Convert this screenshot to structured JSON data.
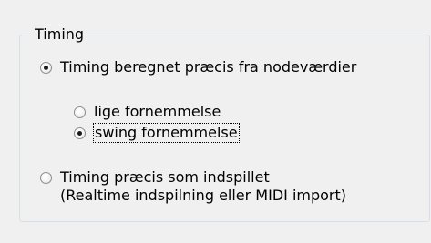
{
  "group": {
    "title": "Timing"
  },
  "options": {
    "calculated": {
      "label": "Timing beregnet præcis fra nodeværdier",
      "checked": true
    },
    "straight": {
      "label": "lige fornemmelse",
      "checked": false
    },
    "swing": {
      "label": "swing fornemmelse",
      "checked": true
    },
    "as_played": {
      "label_line1": "Timing præcis som indspillet",
      "label_line2": "(Realtime indspilning eller MIDI import)",
      "checked": false
    }
  }
}
